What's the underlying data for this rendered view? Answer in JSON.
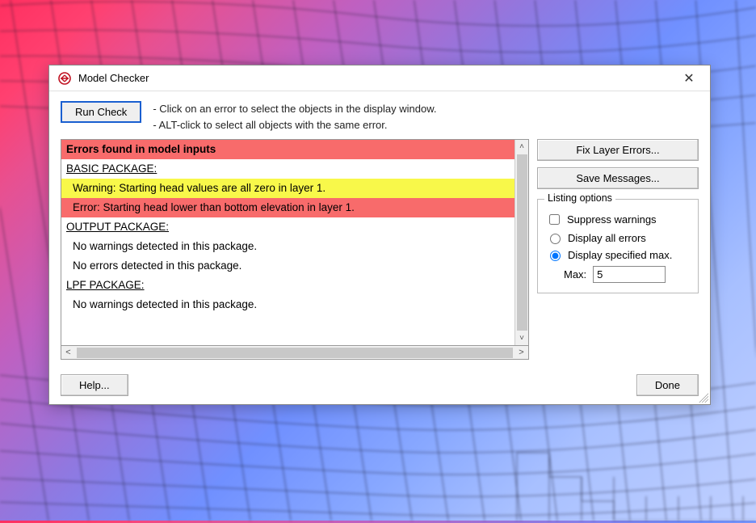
{
  "window": {
    "title": "Model Checker",
    "close_glyph": "✕"
  },
  "toolbar": {
    "run_label": "Run Check",
    "instruction_1": "- Click on an error to select the objects in the display window.",
    "instruction_2": "- ALT-click to select all objects with the same error."
  },
  "messages": {
    "header": "Errors found in model inputs",
    "rows": [
      {
        "kind": "section",
        "text": "BASIC PACKAGE:"
      },
      {
        "kind": "warn",
        "text": "Warning:  Starting head values are all zero in layer 1."
      },
      {
        "kind": "err",
        "text": "Error:  Starting head lower than bottom elevation in layer 1."
      },
      {
        "kind": "section",
        "text": "OUTPUT PACKAGE:"
      },
      {
        "kind": "info",
        "text": "No warnings detected in this package."
      },
      {
        "kind": "info",
        "text": "No errors detected in this package."
      },
      {
        "kind": "section",
        "text": "LPF PACKAGE:"
      },
      {
        "kind": "info",
        "text": "No warnings detected in this package."
      }
    ]
  },
  "side": {
    "fix_label": "Fix Layer Errors...",
    "save_label": "Save Messages...",
    "group_legend": "Listing options",
    "suppress_label": "Suppress warnings",
    "suppress_checked": false,
    "display_all_label": "Display all errors",
    "display_max_label": "Display specified max.",
    "display_mode": "max",
    "max_label": "Max:",
    "max_value": "5"
  },
  "bottom": {
    "help_label": "Help...",
    "done_label": "Done"
  }
}
